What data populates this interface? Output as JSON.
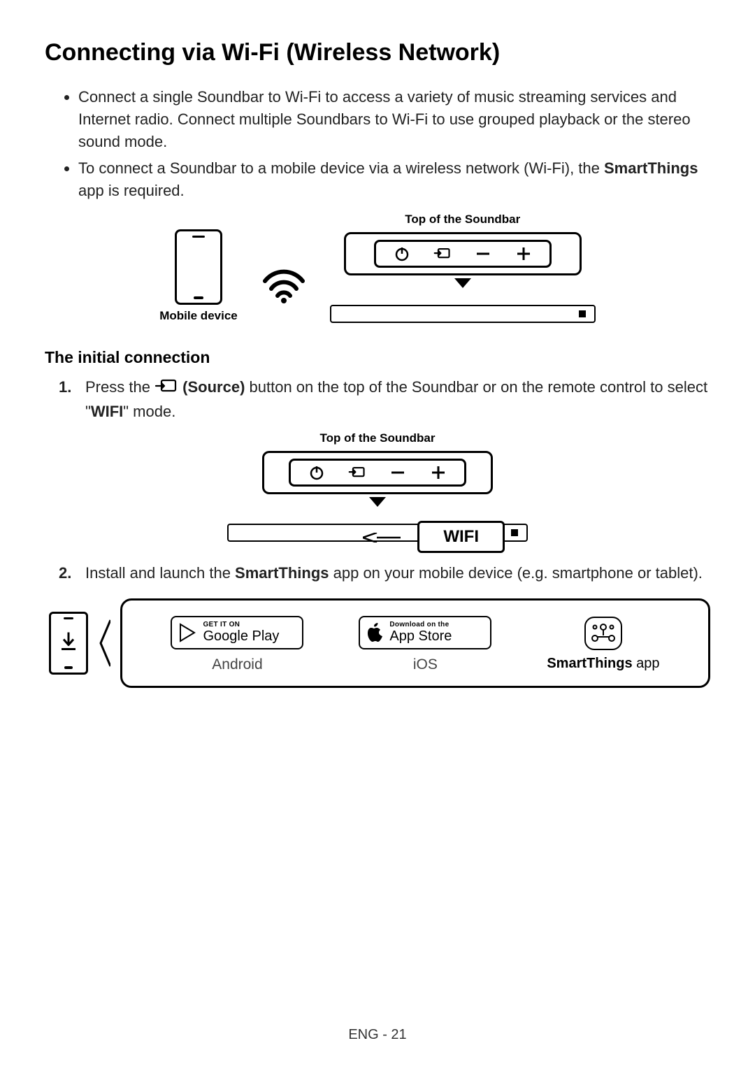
{
  "heading": "Connecting via Wi-Fi (Wireless Network)",
  "bullets": [
    "Connect a single Soundbar to Wi-Fi to access a variety of music streaming services and Internet radio. Connect multiple Soundbars to Wi-Fi to use grouped playback or the stereo sound mode.",
    {
      "pre": "To connect a Soundbar to a mobile device via a wireless network (Wi-Fi), the ",
      "bold": "SmartThings",
      "post": " app is required."
    }
  ],
  "labels": {
    "mobile_device": "Mobile device",
    "top_of_soundbar": "Top of the Soundbar",
    "wifi_badge": "WIFI"
  },
  "subheading": "The initial connection",
  "steps": [
    {
      "num": "1.",
      "pre": "Press the ",
      "bold1": " (Source)",
      "mid": " button on the top of the Soundbar or on the remote control to select \"",
      "bold2": "WIFI",
      "post": "\" mode."
    },
    {
      "num": "2.",
      "pre": "Install and launch the ",
      "bold1": "SmartThings",
      "post": " app on your mobile device (e.g. smartphone or tablet)."
    }
  ],
  "stores": {
    "gp_small": "GET IT ON",
    "gp_big": "Google Play",
    "gp_os": "Android",
    "as_small": "Download on the",
    "as_big": "App Store",
    "as_os": "iOS",
    "st_bold": "SmartThings",
    "st_rest": " app"
  },
  "footer": "ENG - 21"
}
